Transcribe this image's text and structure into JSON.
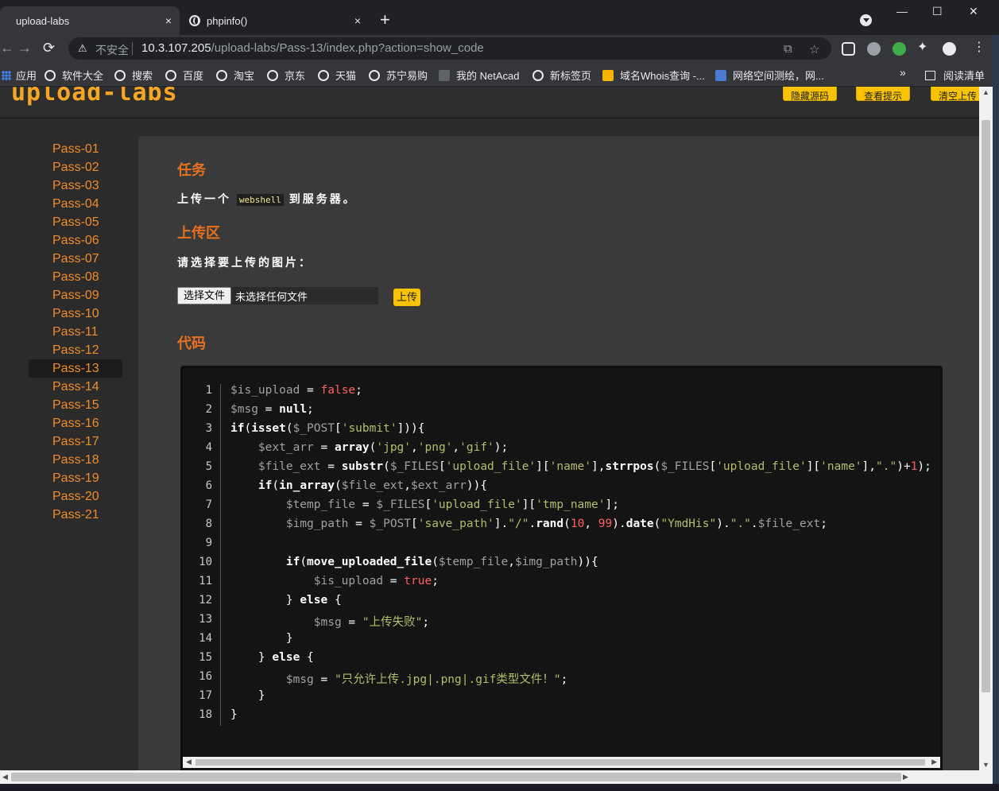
{
  "browser": {
    "tabs": [
      {
        "title": "upload-labs",
        "close": "×"
      },
      {
        "title": "phpinfo()",
        "close": "×"
      }
    ],
    "new_tab": "+",
    "window_controls": {
      "minimize": "—",
      "maximize": "☐",
      "close": "✕"
    },
    "address": {
      "insecure_label": "不安全",
      "host": "10.3.107.205",
      "path": "/upload-labs/Pass-13/index.php?action=show_code"
    },
    "bookmarks": [
      "应用",
      "软件大全",
      "搜索",
      "百度",
      "淘宝",
      "京东",
      "天猫",
      "苏宁易购",
      "我的 NetAcad",
      "新标签页",
      "域名Whois查询 -...",
      "网络空间测绘，网..."
    ],
    "bookmarks_more": "»",
    "reading_list": "阅读清单"
  },
  "site": {
    "logo": "upload-labs",
    "header_buttons": [
      "隐藏源码",
      "查看提示",
      "清空上传"
    ],
    "sidebar": [
      "Pass-01",
      "Pass-02",
      "Pass-03",
      "Pass-04",
      "Pass-05",
      "Pass-06",
      "Pass-07",
      "Pass-08",
      "Pass-09",
      "Pass-10",
      "Pass-11",
      "Pass-12",
      "Pass-13",
      "Pass-14",
      "Pass-15",
      "Pass-16",
      "Pass-17",
      "Pass-18",
      "Pass-19",
      "Pass-20",
      "Pass-21"
    ],
    "active_pass": "Pass-13",
    "task_title": "任务",
    "task_prefix": "上传一个",
    "task_code": "webshell",
    "task_suffix": "到服务器。",
    "upload_title": "上传区",
    "upload_prompt": "请选择要上传的图片：",
    "file_button": "选择文件",
    "file_status": "未选择任何文件",
    "submit_label": "上传",
    "code_title": "代码",
    "code_lines": [
      "$is_upload = false;",
      "$msg = null;",
      "if(isset($_POST['submit'])){",
      "    $ext_arr = array('jpg','png','gif');",
      "    $file_ext = substr($_FILES['upload_file']['name'],strrpos($_FILES['upload_file']['name'],\".\")+1);",
      "    if(in_array($file_ext,$ext_arr)){",
      "        $temp_file = $_FILES['upload_file']['tmp_name'];",
      "        $img_path = $_POST['save_path'].\"/\".rand(10, 99).date(\"YmdHis\").\".\".$file_ext;",
      "",
      "        if(move_uploaded_file($temp_file,$img_path)){",
      "            $is_upload = true;",
      "        } else {",
      "            $msg = \"上传失败\";",
      "        }",
      "    } else {",
      "        $msg = \"只允许上传.jpg|.png|.gif类型文件！\";",
      "    }",
      "}"
    ]
  },
  "colors": {
    "accent_orange": "#e8711f",
    "pass_link": "#f08c2a",
    "button_yellow": "#f9c300",
    "php_variable": "#a0a0a0",
    "php_string": "#b5bd68",
    "php_keyword": "#ffffff",
    "php_number": "#ff6060"
  }
}
